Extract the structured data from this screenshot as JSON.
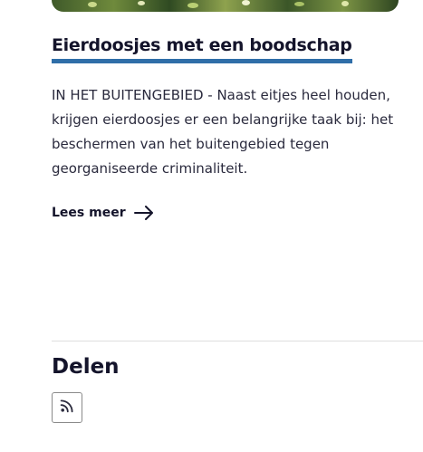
{
  "article": {
    "title": "Eierdoosjes met een boodschap",
    "body": "IN HET BUITENGEBIED - Naast eitjes heel houden, krijgen eierdoosjes er een belangrijke taak bij: het beschermen van het buitengebied tegen georganiseerde criminaliteit.",
    "read_more_label": "Lees meer",
    "read_more_icon": "arrow-right-icon",
    "title_underline_color": "#2f6ea8"
  },
  "share": {
    "heading": "Delen",
    "buttons": [
      {
        "icon": "rss-icon"
      }
    ]
  }
}
